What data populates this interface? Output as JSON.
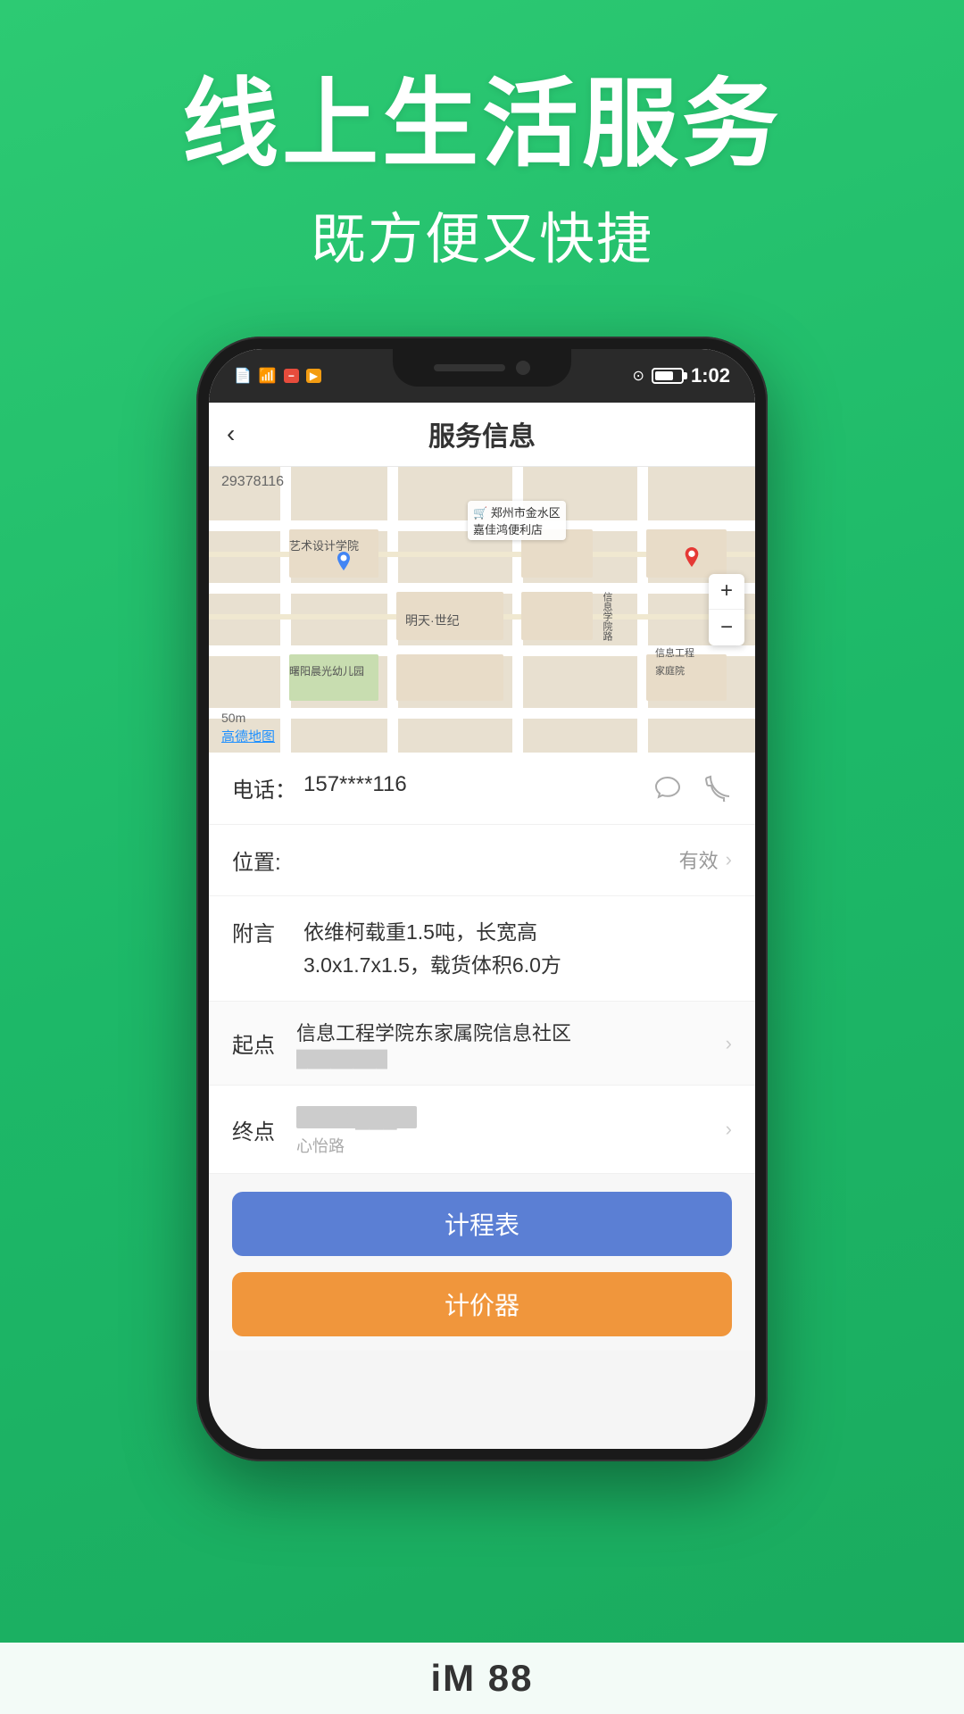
{
  "hero": {
    "title": "线上生活服务",
    "subtitle": "既方便又快捷"
  },
  "status_bar": {
    "time": "1:02",
    "icons_left": [
      "document",
      "wifi",
      "minus-red",
      "play-orange",
      "location"
    ]
  },
  "app_header": {
    "back_label": "‹",
    "title": "服务信息"
  },
  "map": {
    "id": "29378116",
    "scale": "50m",
    "brand": "高德地图",
    "store_name": "郑州市金水区\n嘉佳鸿便利店",
    "labels": [
      "艺术设计学院",
      "曙阳晨光幼儿园",
      "明天·世纪",
      "信息学院路",
      "信息工家庭院"
    ],
    "zoom_plus": "+",
    "zoom_minus": "−"
  },
  "info": {
    "phone_label": "电话：",
    "phone_value": "157****116",
    "location_label": "位置:",
    "location_status": "有效",
    "note_label": "附言",
    "note_value": "依维柯载重1.5吨，长宽高\n3.0x1.7x1.5，载货体积6.0方",
    "start_label": "起点",
    "start_main": "信息工程学院东家属院信息社区",
    "start_sub": "██████████",
    "end_label": "终点",
    "end_main": "心怡路███号",
    "end_sub": "心怡路"
  },
  "buttons": {
    "schedule": "计程表",
    "calculator": "计价器"
  },
  "bottom_bar": {
    "text": "iM 88"
  }
}
